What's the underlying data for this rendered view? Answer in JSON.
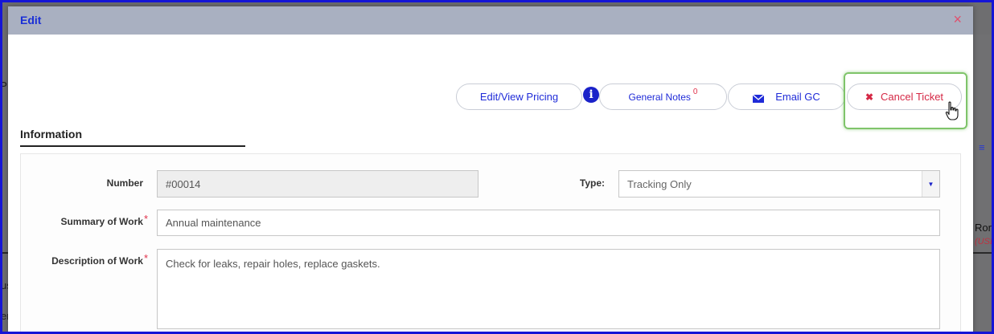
{
  "modal": {
    "title": "Edit",
    "close_glyph": "×"
  },
  "toolbar": {
    "pricing_label": "Edit/View Pricing",
    "info_glyph": "i",
    "notes_label": "General Notes",
    "notes_count": "0",
    "email_label": "Email GC",
    "cancel_glyph": "✖",
    "cancel_label": "Cancel Ticket"
  },
  "section": {
    "title": "Information"
  },
  "form": {
    "number_label": "Number",
    "number_value": "#00014",
    "type_label": "Type:",
    "type_value": "Tracking Only",
    "type_arrow": "▼",
    "summary_label": "Summary of Work",
    "summary_value": "Annual maintenance",
    "description_label": "Description of Work",
    "description_value": "Check for leaks, repair holes, replace gaskets.",
    "required_mark": "*"
  },
  "background": {
    "frag_p": "P",
    "frag_us": "us",
    "frag_er": "er",
    "frag_ror": "Ror",
    "frag_usd": "(USD"
  },
  "colors": {
    "header_bg": "#a9b0c1",
    "accent_blue": "#1f2bd8",
    "danger_red": "#d52845",
    "highlight_green": "#7fc46a",
    "frame_blue": "#1515d6"
  },
  "icons": {
    "info": "info-icon",
    "envelope": "envelope-icon",
    "close": "close-icon",
    "cancel": "x-icon",
    "cursor": "hand-pointer-icon",
    "dropdown": "chevron-down-icon"
  }
}
